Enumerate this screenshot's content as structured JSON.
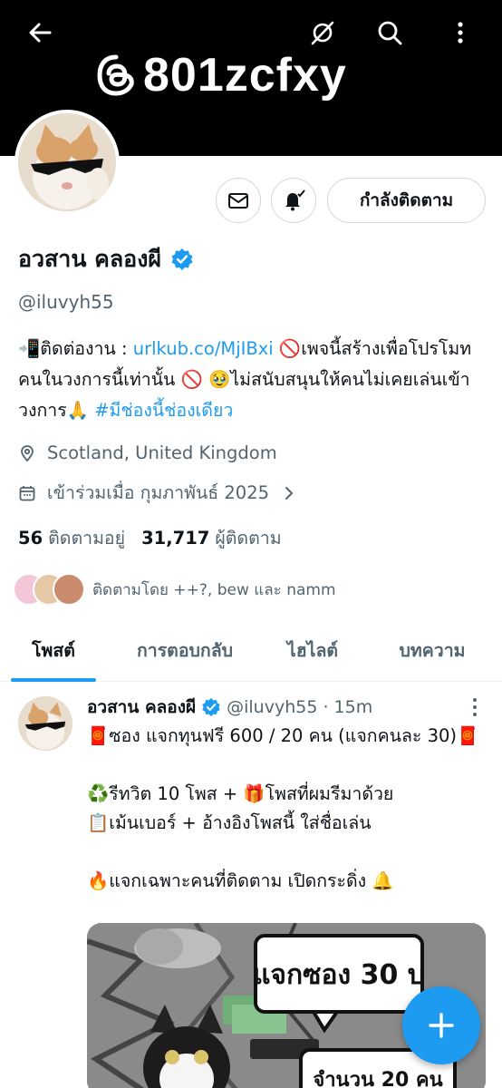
{
  "header": {
    "banner_text": "801zcfxy",
    "back_icon": "back-arrow-icon",
    "icons": [
      "grok-icon",
      "search-icon",
      "more-vertical-icon"
    ]
  },
  "profile": {
    "display_name": "อวสาน คลองผี",
    "handle": "@iluvyh55",
    "follow_button_label": "กำลังติดตาม",
    "bio_prefix": "📲ติดต่องาน : ",
    "bio_link": "urlkub.co/MjIBxi",
    "bio_mid": " 🚫เพจนี้สร้างเพื่อโปรโมทคนในวงการนี้เท่านั้น 🚫 🥹ไม่สนับสนุนให้คนไม่เคยเล่นเข้าวงการ🙏 ",
    "bio_hashtag": "#มีช่องนี้ช่องเดียว",
    "location": "Scotland, United Kingdom",
    "joined": "เข้าร่วมเมื่อ กุมภาพันธ์ 2025",
    "following_count": "56",
    "following_label": "ติดตามอยู่",
    "followers_count": "31,717",
    "followers_label": "ผู้ติดตาม",
    "followed_by": "ติดตามโดย ++?, bew และ namm"
  },
  "tabs": [
    {
      "label": "โพสต์",
      "active": true
    },
    {
      "label": "การตอบกลับ",
      "active": false
    },
    {
      "label": "ไฮไลต์",
      "active": false
    },
    {
      "label": "บทความ",
      "active": false
    }
  ],
  "post": {
    "name": "อวสาน คลองผี",
    "handle": "@iluvyh55",
    "time": "· 15m",
    "body": "🧧ซอง แจกทุนฟรี 600 / 20 คน (แจกคนละ 30)🧧\n\n♻️รีทวิต 10 โพส + 🎁โพสที่ผมรีมาด้วย\n📋เม้นเบอร์ +  อ้างอิงโพสนี้ ใส่ชื่อเล่น\n\n🔥แจกเฉพาะคนที่ติดตาม เปิดกระดิ่ง 🔔",
    "image_text_1": "แจกซอง 30 บ",
    "image_text_2": "จำนวน 20 คน"
  },
  "colors": {
    "accent": "#1d9bf0",
    "text": "#0f1419",
    "secondary": "#536471",
    "banner": "#000000"
  }
}
